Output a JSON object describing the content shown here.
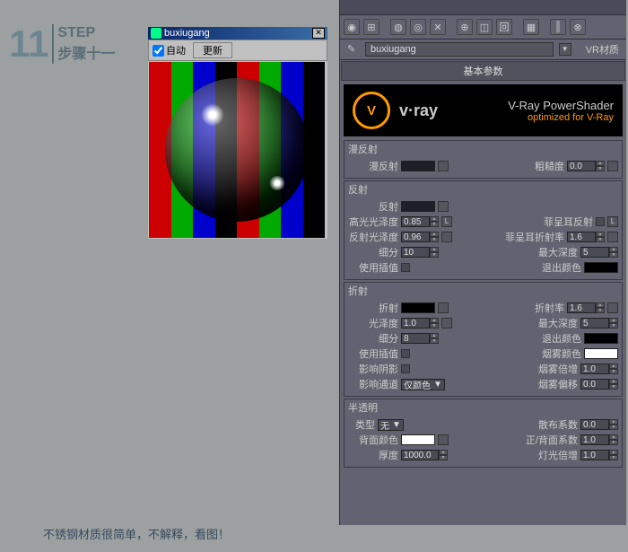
{
  "step": {
    "num": "11",
    "en": "STEP",
    "cn": "步骤十一"
  },
  "preview": {
    "title": "buxiugang",
    "auto": "自动",
    "update": "更新"
  },
  "panel": {
    "matname": "buxiugang",
    "mattype": "VR材质",
    "basic": "基本参数"
  },
  "banner": {
    "logo": "V",
    "brand": "v·ray",
    "line1": "V-Ray PowerShader",
    "line2": "optimized for V-Ray"
  },
  "diffuse": {
    "group": "漫反射",
    "label": "漫反射",
    "rough": "粗糙度",
    "roughv": "0.0"
  },
  "reflect": {
    "group": "反射",
    "label": "反射",
    "hgloss": "高光光泽度",
    "hglossv": "0.85",
    "rgloss": "反射光泽度",
    "rglossv": "0.96",
    "subdiv": "细分",
    "subdivv": "10",
    "useinterp": "使用插值",
    "fresnel": "菲呈耳反射",
    "fresIOR": "菲呈耳折射率",
    "fresIORv": "1.6",
    "maxdepth": "最大深度",
    "maxdepthv": "5",
    "exitcolor": "退出颜色"
  },
  "refract": {
    "group": "折射",
    "label": "折射",
    "gloss": "光泽度",
    "glossv": "1.0",
    "subdiv": "细分",
    "subdivv": "8",
    "useinterp": "使用插值",
    "shadow": "影响阴影",
    "channel": "影响通道",
    "channelv": "仅颜色",
    "ior": "折射率",
    "iorv": "1.6",
    "maxdepth": "最大深度",
    "maxdepthv": "5",
    "exitcolor": "退出颜色",
    "fogcolor": "烟雾颜色",
    "fogmult": "烟雾倍增",
    "fogmultv": "1.0",
    "fogbias": "烟雾偏移",
    "fogbiasv": "0.0"
  },
  "trans": {
    "group": "半透明",
    "type": "类型",
    "typev": "无",
    "backcolor": "背面颜色",
    "thickness": "厚度",
    "thicknessv": "1000.0",
    "scatter": "散布系数",
    "scatterv": "0.0",
    "fbcoef": "正/背面系数",
    "fbcoefv": "1.0",
    "lightmult": "灯光倍增",
    "lightmultv": "1.0"
  },
  "caption": "不锈钢材质很简单，不解释，看图！"
}
